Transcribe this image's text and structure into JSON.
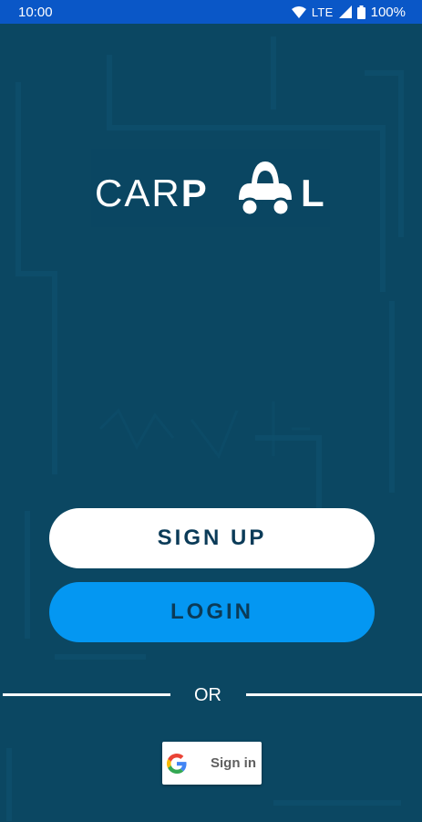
{
  "status_bar": {
    "time": "10:00",
    "network": "LTE",
    "battery": "100%",
    "background": "#0a57c7"
  },
  "logo": {
    "prefix": "CAR",
    "p": "P",
    "l": "L"
  },
  "actions": {
    "signup_label": "SIGN UP",
    "login_label": "LOGIN",
    "signup_color": "#ffffff",
    "login_color": "#0497f2"
  },
  "divider": {
    "text": "OR"
  },
  "google": {
    "label": "Sign in",
    "icon": "google-g-icon"
  },
  "theme": {
    "background": "#0b4762",
    "text_dark": "#0b3b58"
  }
}
